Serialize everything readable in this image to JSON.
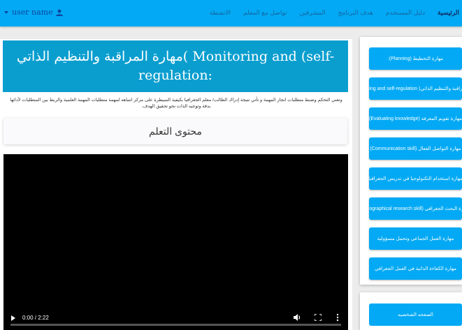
{
  "header": {
    "user_name": "user name",
    "nav": [
      "الرئيسية",
      "دليل المستخدم",
      "هدف البرنامج",
      "المشرفين",
      "تواصل مع المعلم",
      "الانشطة"
    ]
  },
  "lesson": {
    "title": "مهارة المراقبة والتنظيم الذاتي( Monitoring and (self-regulation:",
    "description": "وتعني التحكم وضبط متطلبات انجاز المهمة و تأتي نتيجة إدراك الطالب/ معلم الجغرافيا بكيفية السيطرة على مركز انتباهه لمهمة متطلبات المهمة العلمية والربط بين المتطلبات لأدائها بدقة وتوجيه الذات نحو تحقيق الهدف.",
    "content_title": "محتوى التعلم"
  },
  "video": {
    "time": "0:00 / 2:22",
    "progress": 0.0
  },
  "sidebar": {
    "skills": [
      "مهارة التخطيط (Planning):",
      "مهارة المراقبة والتنظيم الذاتي( Monitoring and self-regulation):",
      "مهارة تقويم المعرفة (Evaluating knowledge)",
      "مهارة التواصل الفعال (Communication skill)",
      "مهارة استخدام التكنولوجيا في تدريس الجغرافيا",
      "مهارة البحث الجغرافي (Geographical research skill)",
      "مهارة العمل الجماعي وتحمل مسؤولية",
      "مهارة الكفاءة الذاتية في العمل الجغرافي"
    ],
    "personal_page": "الصفحه الشخصيه"
  },
  "colors": {
    "topbar": "#03a9f4",
    "header_box": "#0a9ecf",
    "button": "#03a9f4"
  }
}
